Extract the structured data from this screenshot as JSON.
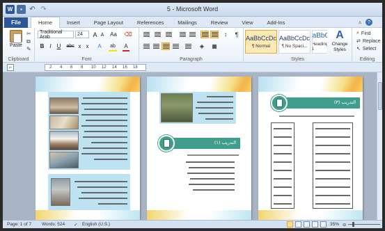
{
  "window": {
    "title": "5 - Microsoft Word",
    "logo_letter": "W"
  },
  "tabs": {
    "file": "File",
    "items": [
      "Home",
      "Insert",
      "Page Layout",
      "References",
      "Mailings",
      "Review",
      "View",
      "Add-Ins"
    ],
    "active": "Home"
  },
  "ribbon": {
    "clipboard": {
      "label": "Clipboard",
      "paste": "Paste"
    },
    "font": {
      "label": "Font",
      "name": "Traditional Arab",
      "size": "24",
      "grow": "A",
      "shrink": "A",
      "case": "Aa",
      "bold": "B",
      "italic": "I",
      "underline": "U",
      "strike": "abc",
      "subscript": "x",
      "superscript": "x",
      "effects": "A",
      "highlight": "ab",
      "color": "A",
      "highlight_color": "#f7e500",
      "font_color": "#d0261d"
    },
    "paragraph": {
      "label": "Paragraph"
    },
    "styles": {
      "label": "Styles",
      "items": [
        {
          "sample": "AaBbCcDc",
          "name": "¶ Normal"
        },
        {
          "sample": "AaBbCcDc",
          "name": "¶ No Spaci..."
        },
        {
          "sample": "AaBbC(",
          "name": "Heading 1"
        }
      ],
      "change_styles": "Change Styles",
      "change_glyph": "A"
    },
    "editing": {
      "label": "Editing",
      "find": "Find",
      "replace": "Replace",
      "select": "Select"
    }
  },
  "ruler": {
    "numbers": [
      "2",
      "4",
      "6",
      "8",
      "10",
      "12",
      "14",
      "16",
      "18"
    ]
  },
  "document": {
    "page3_heading": "التدريب (٣)",
    "page2_heading": "التدريب (١)"
  },
  "status": {
    "page": "Page: 1 of 7",
    "words": "Words: 524",
    "language": "English (U.S.)",
    "zoom": "35%"
  },
  "colors": {
    "accent_green": "#3f9e8c",
    "file_tab": "#2b579a"
  }
}
